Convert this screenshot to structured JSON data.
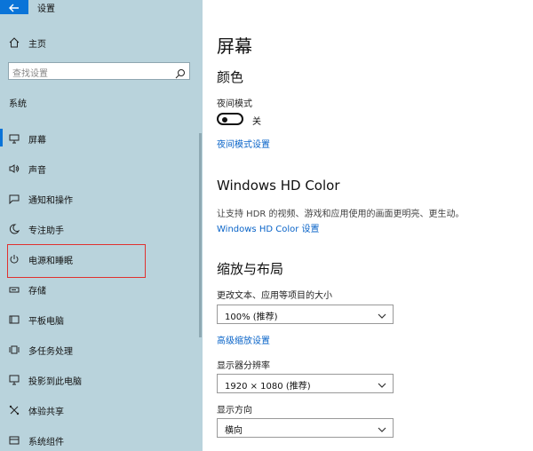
{
  "window": {
    "title": "设置"
  },
  "sidebar": {
    "home": "主页",
    "search_placeholder": "查找设置",
    "section": "系统",
    "items": [
      {
        "label": "屏幕",
        "icon": "monitor-icon"
      },
      {
        "label": "声音",
        "icon": "speaker-icon"
      },
      {
        "label": "通知和操作",
        "icon": "notification-icon"
      },
      {
        "label": "专注助手",
        "icon": "moon-icon"
      },
      {
        "label": "电源和睡眠",
        "icon": "power-icon"
      },
      {
        "label": "存储",
        "icon": "storage-icon"
      },
      {
        "label": "平板电脑",
        "icon": "tablet-icon"
      },
      {
        "label": "多任务处理",
        "icon": "multitask-icon"
      },
      {
        "label": "投影到此电脑",
        "icon": "project-icon"
      },
      {
        "label": "体验共享",
        "icon": "share-icon"
      },
      {
        "label": "系统组件",
        "icon": "components-icon"
      }
    ],
    "active_item": "屏幕",
    "highlighted_item": "电源和睡眠"
  },
  "main": {
    "page_title": "屏幕",
    "color_section": "颜色",
    "night_mode_label": "夜间模式",
    "night_mode_state": "关",
    "night_mode_link": "夜间模式设置",
    "hd_color_section": "Windows HD Color",
    "hd_color_desc": "让支持 HDR 的视频、游戏和应用使用的画面更明亮、更生动。",
    "hd_color_link": "Windows HD Color 设置",
    "scale_section": "缩放与布局",
    "scale_label": "更改文本、应用等项目的大小",
    "scale_value": "100% (推荐)",
    "advanced_scale_link": "高级缩放设置",
    "resolution_label": "显示器分辨率",
    "resolution_value": "1920 × 1080 (推荐)",
    "orientation_label": "显示方向",
    "orientation_value": "横向"
  },
  "colors": {
    "accent": "#0a74d8",
    "sidebar_bg": "#b9d3dc",
    "highlight": "#e0312f",
    "link": "#0a64c8"
  }
}
